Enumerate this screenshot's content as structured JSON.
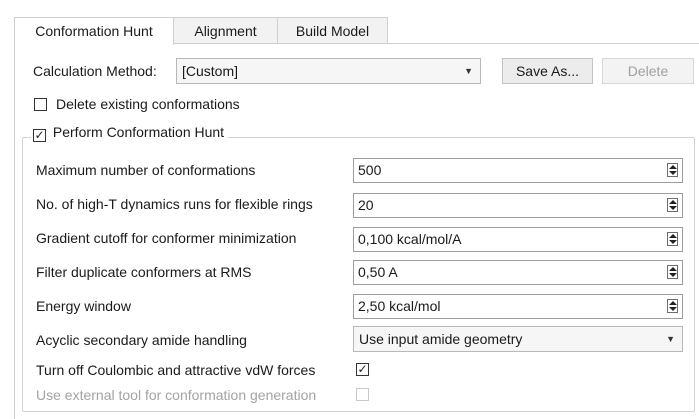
{
  "tabs": [
    {
      "label": "Conformation Hunt",
      "active": true
    },
    {
      "label": "Alignment",
      "active": false
    },
    {
      "label": "Build Model",
      "active": false
    }
  ],
  "calc": {
    "label": "Calculation Method:",
    "value": "[Custom]",
    "save_as": "Save As...",
    "delete": "Delete"
  },
  "delete_existing": {
    "label": "Delete existing conformations",
    "checked": false
  },
  "perform": {
    "label": "Perform Conformation Hunt",
    "checked": true
  },
  "fields": {
    "max_conf": {
      "label": "Maximum number of conformations",
      "value": "500"
    },
    "high_t": {
      "label": "No. of high-T dynamics runs for flexible rings",
      "value": "20"
    },
    "grad_cutoff": {
      "label": "Gradient cutoff for conformer minimization",
      "value": "0,100 kcal/mol/A"
    },
    "filter_dup": {
      "label": "Filter duplicate conformers at RMS",
      "value": "0,50 A"
    },
    "energy_window": {
      "label": "Energy window",
      "value": "2,50 kcal/mol"
    },
    "acyclic": {
      "label": "Acyclic secondary amide handling",
      "value": "Use input amide geometry"
    },
    "coulombic": {
      "label": "Turn off Coulombic and attractive vdW forces",
      "checked": true
    },
    "external_tool": {
      "label": "Use external tool for conformation generation",
      "checked": false,
      "enabled": false
    }
  }
}
